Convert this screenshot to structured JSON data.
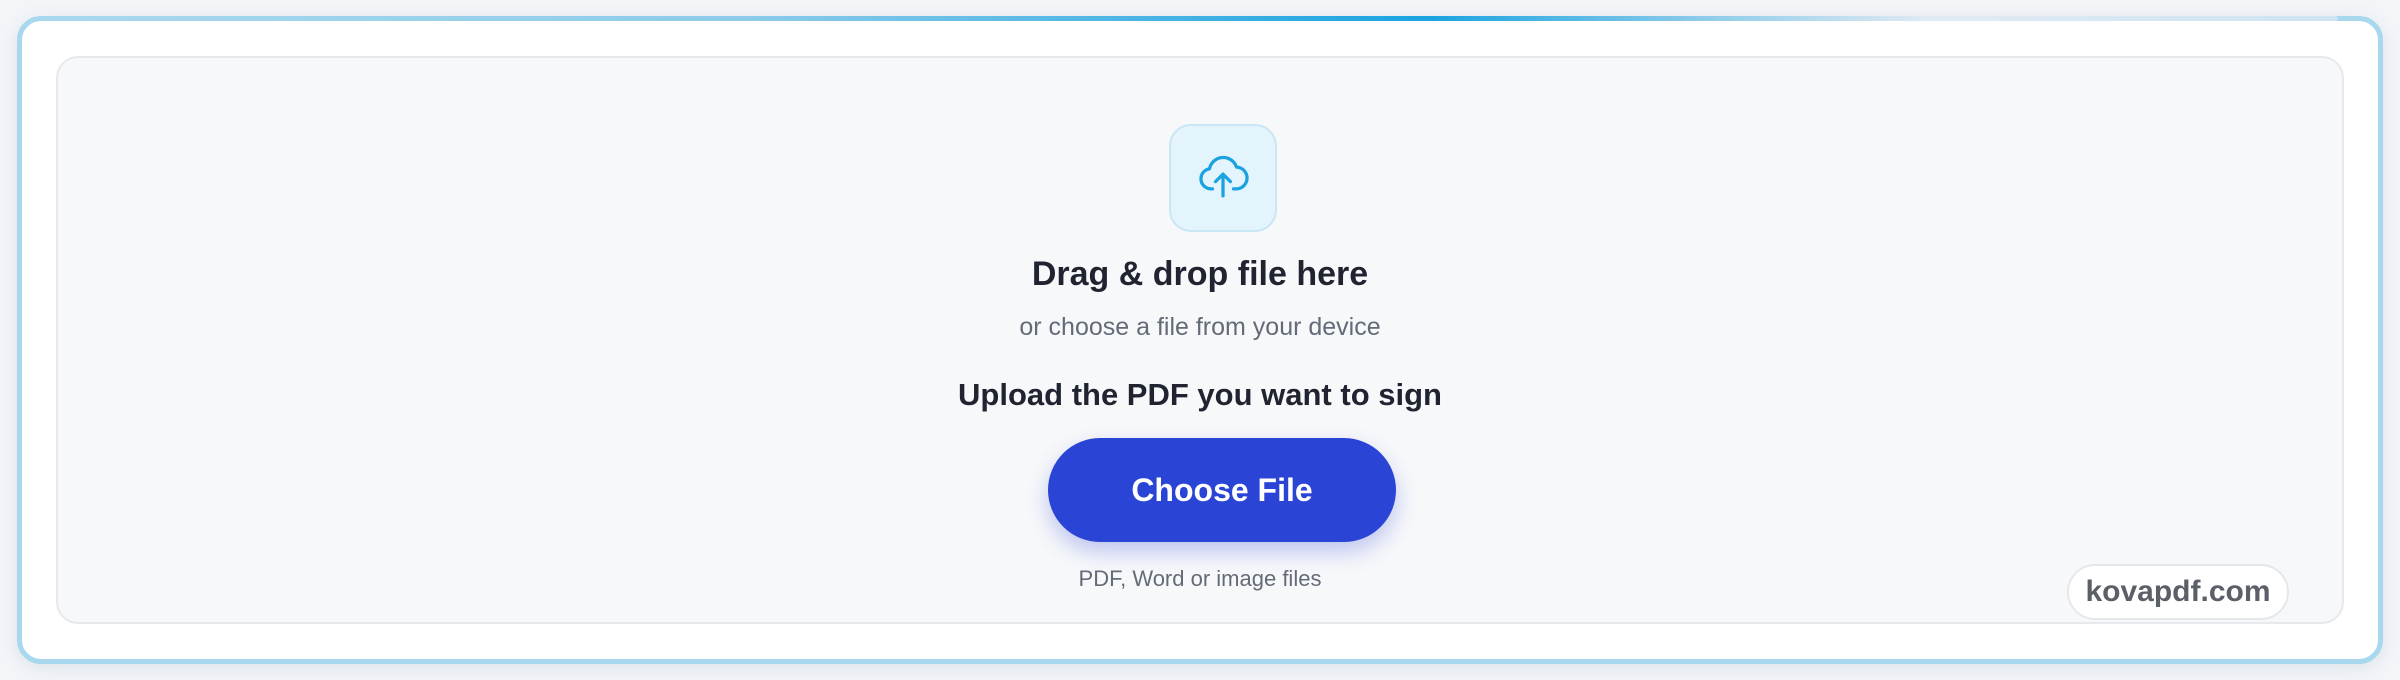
{
  "upload": {
    "icon": "cloud-upload-icon",
    "title": "Drag & drop file here",
    "subtitle": "or choose a file from your device",
    "prompt": "Upload the PDF you want to sign",
    "button_label": "Choose File",
    "formats": "PDF, Word or image files"
  },
  "watermark": {
    "text": "kovapdf.com"
  },
  "colors": {
    "accent": "#2a45d6",
    "icon": "#1aa3e0",
    "border": "#a8d8ee"
  }
}
